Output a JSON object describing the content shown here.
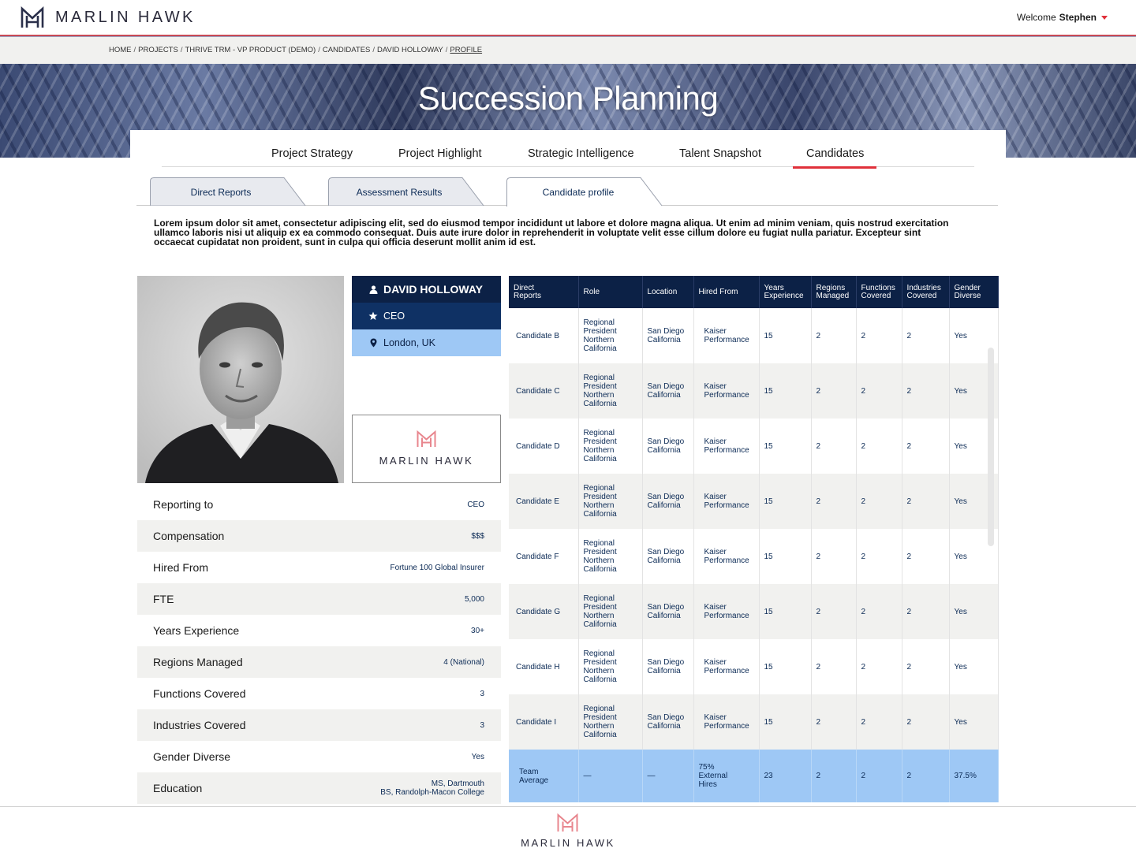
{
  "header": {
    "brand": "MARLIN HAWK",
    "welcome_label": "Welcome",
    "user_name": "Stephen"
  },
  "breadcrumb": {
    "items": [
      "HOME",
      "PROJECTS",
      "THRIVE TRM - VP PRODUCT (DEMO)",
      "CANDIDATES",
      "DAVID HOLLOWAY",
      "PROFILE"
    ]
  },
  "banner": {
    "title": "Succession Planning"
  },
  "nav": {
    "tabs": [
      "Project Strategy",
      "Project Highlight",
      "Strategic Intelligence",
      "Talent Snapshot",
      "Candidates"
    ],
    "active": "Candidates"
  },
  "subtabs": {
    "items": [
      "Direct Reports",
      "Assessment Results",
      "Candidate profile"
    ],
    "active": "Candidate profile"
  },
  "intro": "Lorem ipsum dolor sit amet, consectetur adipiscing elit, sed do eiusmod tempor incididunt ut labore et dolore magna aliqua. Ut enim ad minim veniam, quis nostrud exercitation ullamco laboris nisi ut aliquip ex ea commodo consequat. Duis aute irure dolor in reprehenderit in voluptate velit esse cillum dolore eu fugiat nulla pariatur. Excepteur sint occaecat cupidatat non proident, sunt in culpa qui officia deserunt mollit anim id est.",
  "profile": {
    "name": "DAVID HOLLOWAY",
    "role": "CEO",
    "location": "London, UK",
    "logo_text": "MARLIN HAWK",
    "attributes": [
      {
        "label": "Reporting to",
        "value": "CEO"
      },
      {
        "label": "Compensation",
        "value": "$$$"
      },
      {
        "label": "Hired From",
        "value": "Fortune 100 Global Insurer"
      },
      {
        "label": "FTE",
        "value": "5,000"
      },
      {
        "label": "Years Experience",
        "value": "30+"
      },
      {
        "label": "Regions Managed",
        "value": "4 (National)"
      },
      {
        "label": "Functions Covered",
        "value": "3"
      },
      {
        "label": "Industries Covered",
        "value": "3"
      },
      {
        "label": "Gender Diverse",
        "value": "Yes"
      },
      {
        "label": "Education",
        "value": "MS, Dartmouth",
        "value2": "BS, Randolph-Macon College"
      }
    ]
  },
  "table": {
    "headers": [
      [
        "Direct",
        "Reports"
      ],
      [
        "Role",
        ""
      ],
      [
        "Location",
        ""
      ],
      [
        "Hired From",
        ""
      ],
      [
        "Years",
        "Experience"
      ],
      [
        "Regions",
        "Managed"
      ],
      [
        "Functions",
        "Covered"
      ],
      [
        "Industries",
        "Covered"
      ],
      [
        "Gender",
        "Diverse"
      ]
    ],
    "rows": [
      {
        "candidate": "Candidate B",
        "role": [
          "Regional",
          "President",
          "Northern",
          "California"
        ],
        "location": [
          "San Diego",
          "California"
        ],
        "hired_from": [
          "Kaiser",
          "Performance"
        ],
        "years": "15",
        "regions": "2",
        "functions": "2",
        "industries": "2",
        "gender": "Yes"
      },
      {
        "candidate": "Candidate C",
        "role": [
          "Regional",
          "President",
          "Northern",
          "California"
        ],
        "location": [
          "San Diego",
          "California"
        ],
        "hired_from": [
          "Kaiser",
          "Performance"
        ],
        "years": "15",
        "regions": "2",
        "functions": "2",
        "industries": "2",
        "gender": "Yes"
      },
      {
        "candidate": "Candidate D",
        "role": [
          "Regional",
          "President",
          "Northern",
          "California"
        ],
        "location": [
          "San Diego",
          "California"
        ],
        "hired_from": [
          "Kaiser",
          "Performance"
        ],
        "years": "15",
        "regions": "2",
        "functions": "2",
        "industries": "2",
        "gender": "Yes"
      },
      {
        "candidate": "Candidate E",
        "role": [
          "Regional",
          "President",
          "Northern",
          "California"
        ],
        "location": [
          "San Diego",
          "California"
        ],
        "hired_from": [
          "Kaiser",
          "Performance"
        ],
        "years": "15",
        "regions": "2",
        "functions": "2",
        "industries": "2",
        "gender": "Yes"
      },
      {
        "candidate": "Candidate F",
        "role": [
          "Regional",
          "President",
          "Northern",
          "California"
        ],
        "location": [
          "San Diego",
          "California"
        ],
        "hired_from": [
          "Kaiser",
          "Performance"
        ],
        "years": "15",
        "regions": "2",
        "functions": "2",
        "industries": "2",
        "gender": "Yes"
      },
      {
        "candidate": "Candidate G",
        "role": [
          "Regional",
          "President",
          "Northern",
          "California"
        ],
        "location": [
          "San Diego",
          "California"
        ],
        "hired_from": [
          "Kaiser",
          "Performance"
        ],
        "years": "15",
        "regions": "2",
        "functions": "2",
        "industries": "2",
        "gender": "Yes"
      },
      {
        "candidate": "Candidate H",
        "role": [
          "Regional",
          "President",
          "Northern",
          "California"
        ],
        "location": [
          "San Diego",
          "California"
        ],
        "hired_from": [
          "Kaiser",
          "Performance"
        ],
        "years": "15",
        "regions": "2",
        "functions": "2",
        "industries": "2",
        "gender": "Yes"
      },
      {
        "candidate": "Candidate I",
        "role": [
          "Regional",
          "President",
          "Northern",
          "California"
        ],
        "location": [
          "San Diego",
          "California"
        ],
        "hired_from": [
          "Kaiser",
          "Performance"
        ],
        "years": "15",
        "regions": "2",
        "functions": "2",
        "industries": "2",
        "gender": "Yes"
      }
    ],
    "average": {
      "label": [
        "Team",
        "Average"
      ],
      "role": "—",
      "location": "—",
      "hired_from": [
        "75%",
        "External",
        "Hires"
      ],
      "years": "23",
      "regions": "2",
      "functions": "2",
      "industries": "2",
      "gender": "37.5%"
    }
  },
  "footer": {
    "brand": "MARLIN HAWK"
  },
  "colors": {
    "navy": "#0c2146",
    "accent_red": "#e0303a",
    "light_blue": "#9ec8f5",
    "logo_pink": "#e8868e"
  },
  "icons": [
    "marlin-hawk-logo-icon",
    "caret-down-icon",
    "user-icon",
    "star-icon",
    "map-pin-icon"
  ]
}
